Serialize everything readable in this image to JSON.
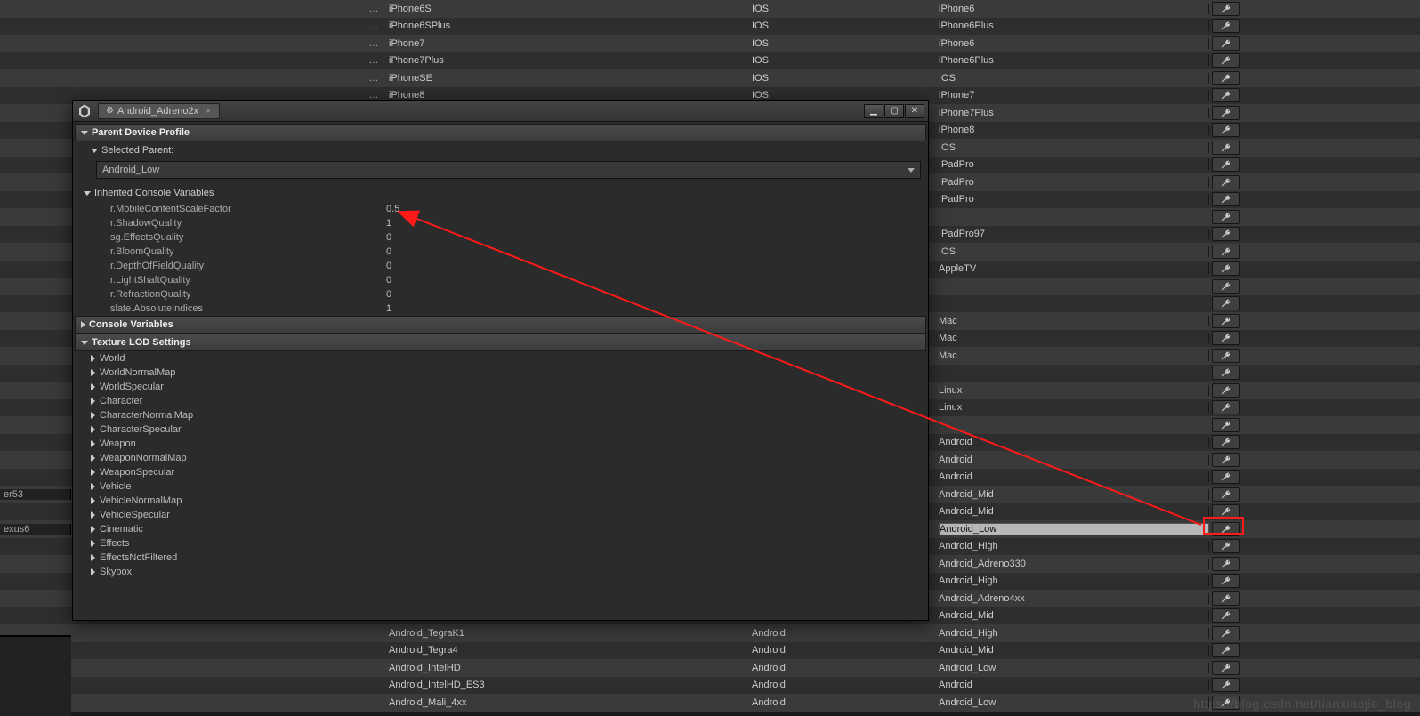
{
  "dialog": {
    "tab_title": "Android_Adreno2x",
    "sections": {
      "parent_title": "Parent Device Profile",
      "selected_parent_label": "Selected Parent:",
      "selected_parent_value": "Android_Low",
      "inherited_title": "Inherited Console Variables",
      "console_vars_title": "Console Variables",
      "texture_lod_title": "Texture LOD Settings"
    },
    "inherited_cvars": [
      {
        "name": "r.MobileContentScaleFactor",
        "value": "0.5"
      },
      {
        "name": "r.ShadowQuality",
        "value": "1"
      },
      {
        "name": "sg.EffectsQuality",
        "value": "0"
      },
      {
        "name": "r.BloomQuality",
        "value": "0"
      },
      {
        "name": "r.DepthOfFieldQuality",
        "value": "0"
      },
      {
        "name": "r.LightShaftQuality",
        "value": "0"
      },
      {
        "name": "r.RefractionQuality",
        "value": "0"
      },
      {
        "name": "slate.AbsoluteIndices",
        "value": "1"
      }
    ],
    "lod_groups": [
      "World",
      "WorldNormalMap",
      "WorldSpecular",
      "Character",
      "CharacterNormalMap",
      "CharacterSpecular",
      "Weapon",
      "WeaponNormalMap",
      "WeaponSpecular",
      "Vehicle",
      "VehicleNormalMap",
      "VehicleSpecular",
      "Cinematic",
      "Effects",
      "EffectsNotFiltered",
      "Skybox"
    ]
  },
  "left_sidebar_labels": {
    "er53": "er53",
    "exus6": "exus6"
  },
  "bg_rows": [
    {
      "ellipsis": "…",
      "name": "iPhone6S",
      "platform": "IOS",
      "base": "iPhone6"
    },
    {
      "ellipsis": "…",
      "name": "iPhone6SPlus",
      "platform": "IOS",
      "base": "iPhone6Plus"
    },
    {
      "ellipsis": "…",
      "name": "iPhone7",
      "platform": "IOS",
      "base": "iPhone6"
    },
    {
      "ellipsis": "…",
      "name": "iPhone7Plus",
      "platform": "IOS",
      "base": "iPhone6Plus"
    },
    {
      "ellipsis": "…",
      "name": "iPhoneSE",
      "platform": "IOS",
      "base": "IOS"
    },
    {
      "ellipsis": "…",
      "name": "iPhone8",
      "platform": "IOS",
      "base": "iPhone7"
    },
    {
      "ellipsis": "",
      "name": "",
      "platform": "",
      "base": "iPhone7Plus"
    },
    {
      "ellipsis": "",
      "name": "",
      "platform": "",
      "base": "iPhone8"
    },
    {
      "ellipsis": "",
      "name": "",
      "platform": "",
      "base": "IOS"
    },
    {
      "ellipsis": "",
      "name": "",
      "platform": "",
      "base": "IPadPro"
    },
    {
      "ellipsis": "",
      "name": "",
      "platform": "",
      "base": "IPadPro"
    },
    {
      "ellipsis": "",
      "name": "",
      "platform": "",
      "base": "IPadPro"
    },
    {
      "ellipsis": "",
      "name": "",
      "platform": "",
      "base": ""
    },
    {
      "ellipsis": "",
      "name": "",
      "platform": "",
      "base": "IPadPro97"
    },
    {
      "ellipsis": "",
      "name": "",
      "platform": "",
      "base": "IOS"
    },
    {
      "ellipsis": "",
      "name": "",
      "platform": "",
      "base": "AppleTV"
    },
    {
      "ellipsis": "",
      "name": "",
      "platform": "",
      "base": ""
    },
    {
      "ellipsis": "",
      "name": "",
      "platform": "",
      "base": ""
    },
    {
      "ellipsis": "",
      "name": "",
      "platform": "",
      "base": "Mac"
    },
    {
      "ellipsis": "",
      "name": "",
      "platform": "",
      "base": "Mac"
    },
    {
      "ellipsis": "",
      "name": "",
      "platform": "",
      "base": "Mac"
    },
    {
      "ellipsis": "",
      "name": "",
      "platform": "",
      "base": ""
    },
    {
      "ellipsis": "",
      "name": "",
      "platform": "",
      "base": "Linux"
    },
    {
      "ellipsis": "",
      "name": "",
      "platform": "",
      "base": "Linux"
    },
    {
      "ellipsis": "",
      "name": "",
      "platform": "",
      "base": ""
    },
    {
      "ellipsis": "",
      "name": "",
      "platform": "",
      "base": "Android"
    },
    {
      "ellipsis": "",
      "name": "",
      "platform": "",
      "base": "Android"
    },
    {
      "ellipsis": "",
      "name": "",
      "platform": "",
      "base": "Android"
    },
    {
      "ellipsis": "",
      "name": "",
      "platform": "",
      "base": "Android_Mid",
      "left": "er53"
    },
    {
      "ellipsis": "",
      "name": "",
      "platform": "",
      "base": "Android_Mid"
    },
    {
      "ellipsis": "",
      "name": "",
      "platform": "",
      "base": "Android_Low",
      "selected": true,
      "left": "exus6"
    },
    {
      "ellipsis": "",
      "name": "",
      "platform": "",
      "base": "Android_High"
    },
    {
      "ellipsis": "",
      "name": "",
      "platform": "",
      "base": "Android_Adreno330"
    },
    {
      "ellipsis": "",
      "name": "",
      "platform": "",
      "base": "Android_High"
    },
    {
      "ellipsis": "",
      "name": "",
      "platform": "",
      "base": "Android_Adreno4xx"
    },
    {
      "ellipsis": "",
      "name": "",
      "platform": "",
      "base": "Android_Mid"
    },
    {
      "ellipsis": "",
      "name": "Android_TegraK1",
      "platform": "Android",
      "base": "Android_High"
    },
    {
      "ellipsis": "",
      "name": "Android_Tegra4",
      "platform": "Android",
      "base": "Android_Mid"
    },
    {
      "ellipsis": "",
      "name": "Android_IntelHD",
      "platform": "Android",
      "base": "Android_Low"
    },
    {
      "ellipsis": "",
      "name": "Android_IntelHD_ES3",
      "platform": "Android",
      "base": "Android"
    },
    {
      "ellipsis": "",
      "name": "Android_Mali_4xx",
      "platform": "Android",
      "base": "Android_Low"
    }
  ],
  "watermark": "https://blog.csdn.net/tianxiaojie_blog"
}
